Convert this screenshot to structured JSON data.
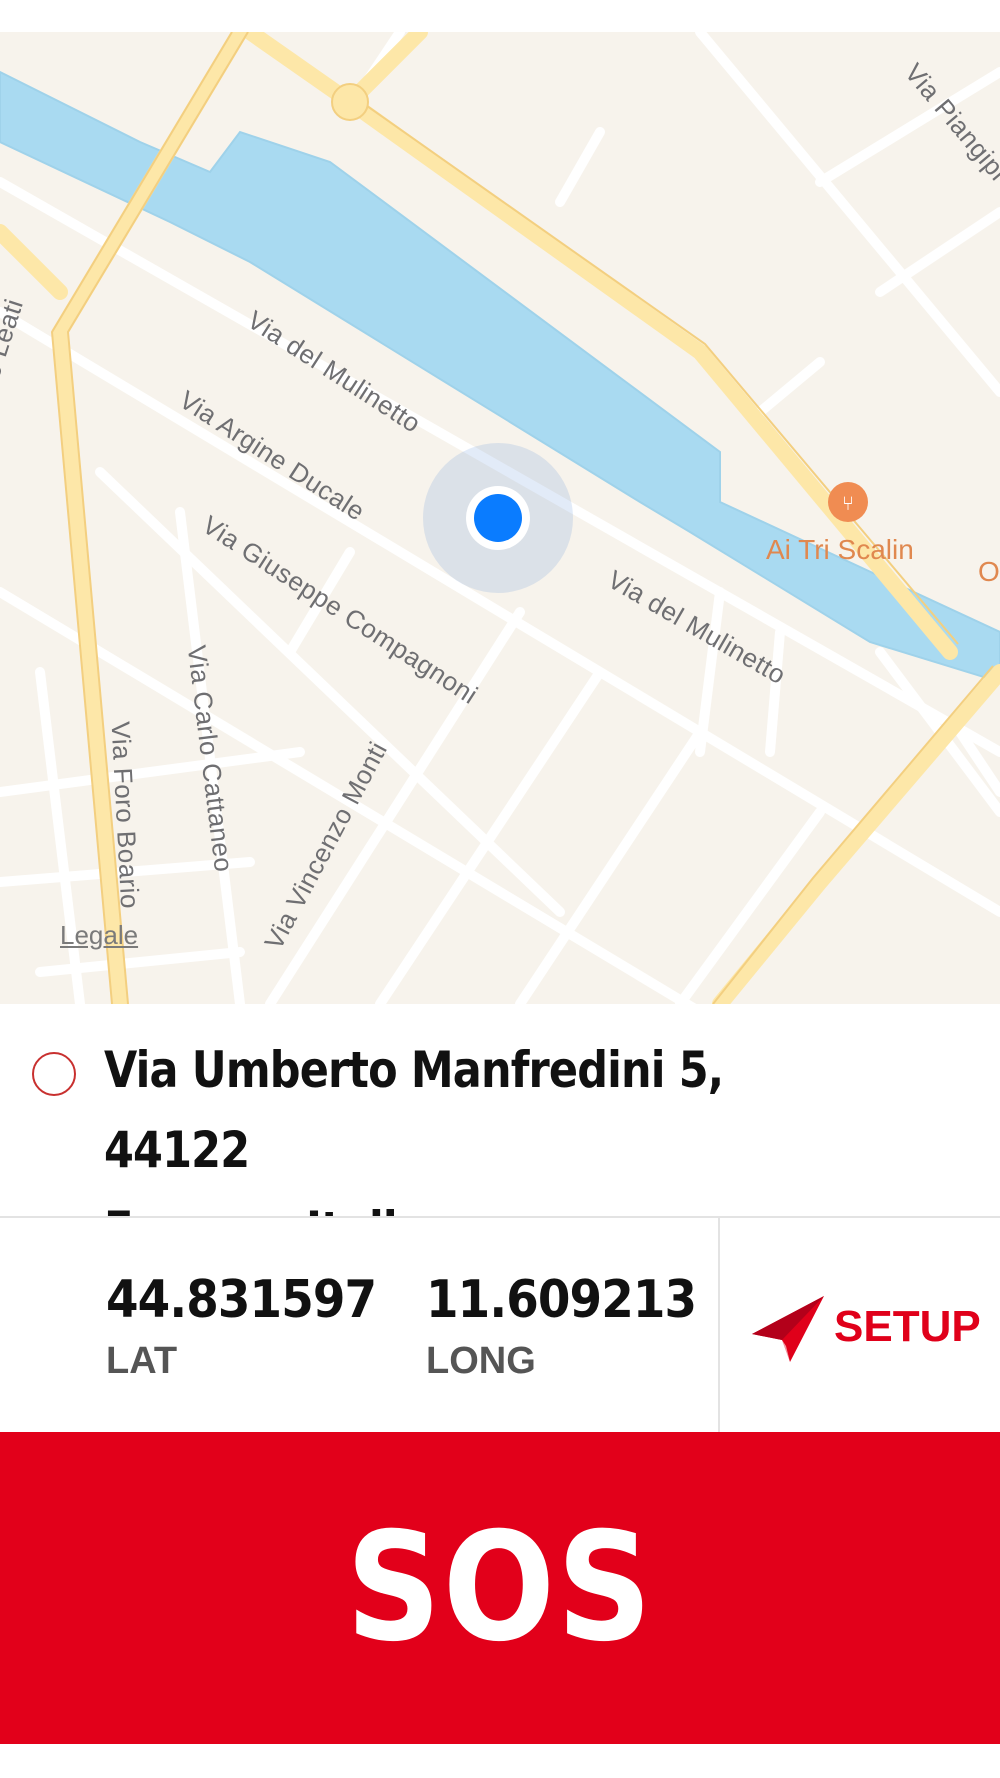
{
  "map": {
    "street_labels": {
      "via_pianipi": "Via Piangipi",
      "leati": "o Leati",
      "mulinetto_1": "Via del Mulinetto",
      "argine_ducale": "Via Argine Ducale",
      "giuseppe_compagnoni": "Via Giuseppe Compagnoni",
      "mulinetto_2": "Via del Mulinetto",
      "carlo_cattaneo": "Via Carlo Cattaneo",
      "foro_boario": "Via Foro Boario",
      "vincenzo_monti": "Via Vincenzo Monti"
    },
    "poi_label": "Ai Tri Scalin",
    "poi_edge_label": "O",
    "legal_link": "Legale",
    "colors": {
      "land": "#f7f3ec",
      "water": "#a9daf1",
      "major_road": "#fde7a8",
      "pin": "#0a7cff",
      "poi": "#e0884f"
    }
  },
  "address": {
    "line1": "Via Umberto Manfredini 5, 44122",
    "line2": "Ferrara, Italia"
  },
  "coords": {
    "lat_value": "44.831597",
    "lat_label": "LAT",
    "long_value": "11.609213",
    "long_label": "LONG"
  },
  "setup": {
    "label": "SETUP",
    "icon": "paper-plane-icon"
  },
  "sos": {
    "label": "SOS",
    "color": "#e2001a"
  }
}
